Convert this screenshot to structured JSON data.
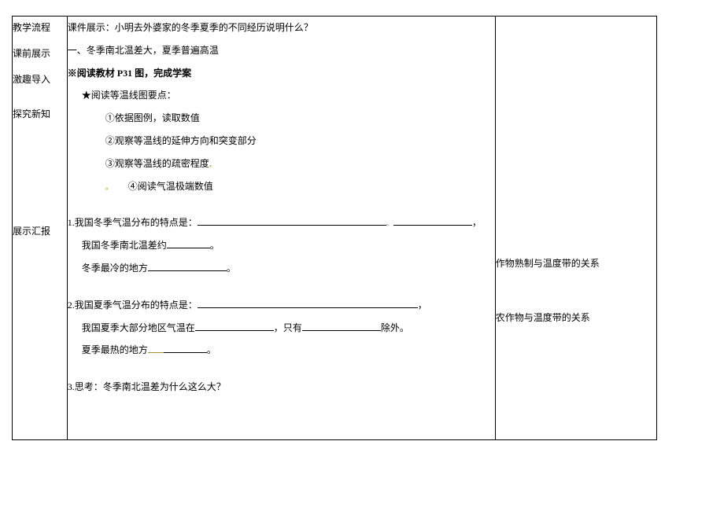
{
  "leftLabels": {
    "l1": "教学流程",
    "l2": "课前展示",
    "l3": "激趣导入",
    "l4": "探究新知",
    "l5": "展示汇报"
  },
  "mid": {
    "line1": "课件展示：小明去外婆家的冬季夏季的不同经历说明什么？",
    "line2": "一、冬季南北温差大，夏季普遍高温",
    "line3": "※阅读教材 P31 图，完成学案",
    "line4": "★阅读等温线图要点：",
    "line5": "①依据图例，读取数值",
    "line6": "②观察等温线的延伸方向和突变部分",
    "line7": "③观察等温线的疏密程度",
    "line8": "④阅读气温极端数值",
    "q1_pre": "1.我国冬季气温分布的特点是：",
    "q1_suf": "，",
    "q1b_pre": "我国冬季南北温差约",
    "q1b_suf": "。",
    "q1c_pre": "冬季最冷的地方",
    "q1c_suf": "。",
    "q2_pre": "2.我国夏季气温分布的特点是：",
    "q2_suf": "，",
    "q2b_pre": "我国夏季大部分地区气温在",
    "q2b_mid": "，只有",
    "q2b_suf": "除外。",
    "q2c_pre": "夏季最热的地方",
    "q2c_suf": "。",
    "q3": "3.思考：冬季南北温差为什么这么大？"
  },
  "right": {
    "r1": "作物熟制与温度带的关系",
    "r2": "农作物与温度带的关系"
  }
}
